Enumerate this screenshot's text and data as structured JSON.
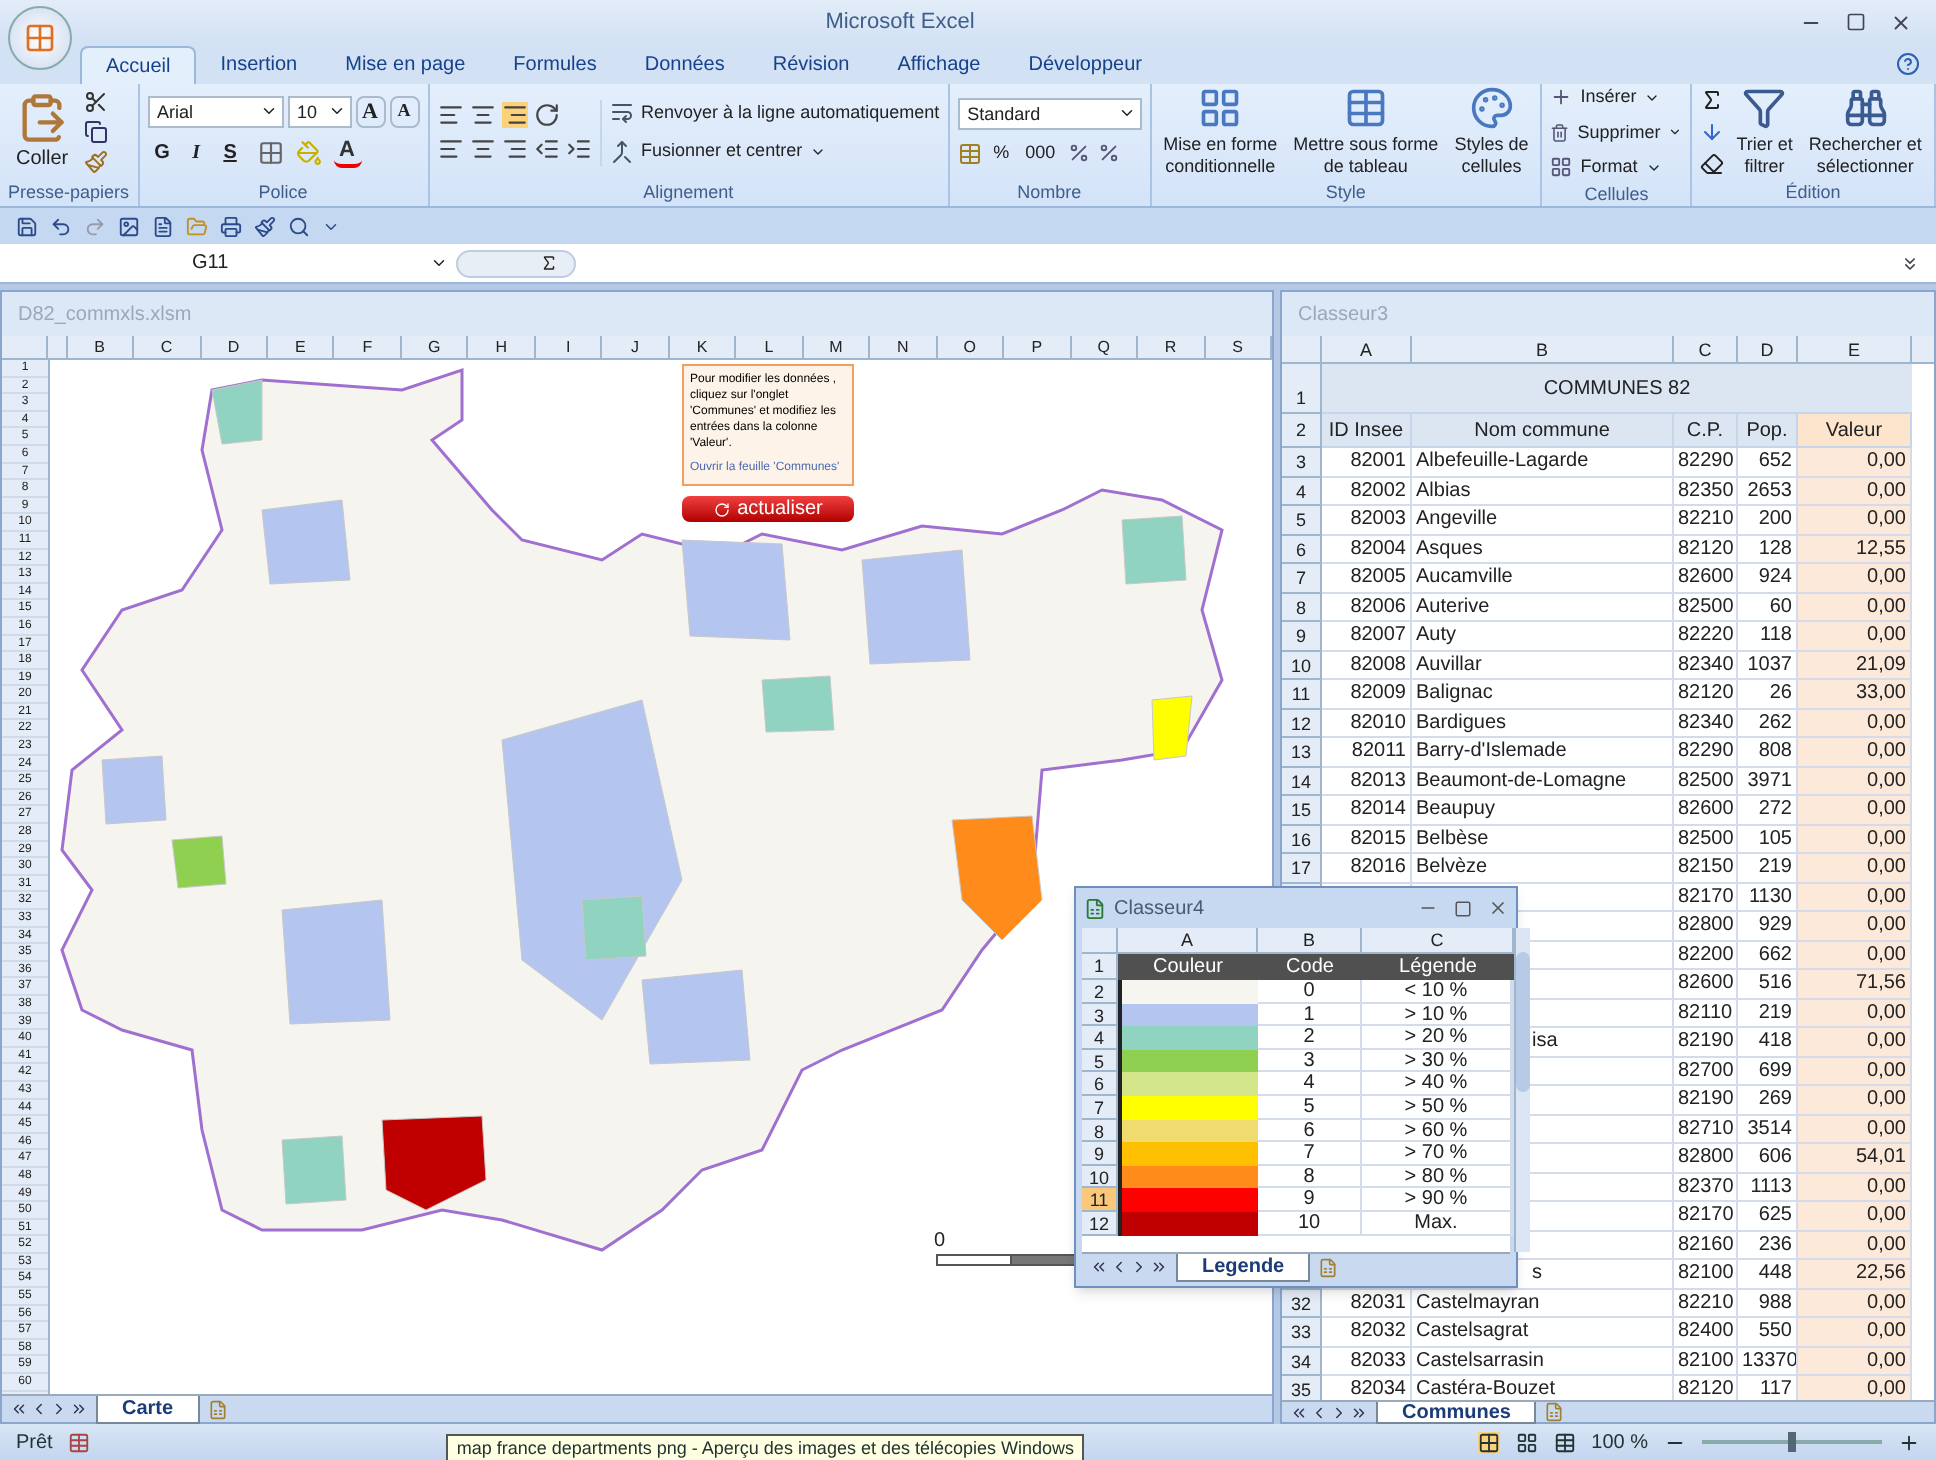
{
  "window": {
    "title": "Microsoft Excel"
  },
  "tabs": [
    {
      "label": "Accueil",
      "selected": true
    },
    {
      "label": "Insertion",
      "selected": false
    },
    {
      "label": "Mise en page",
      "selected": false
    },
    {
      "label": "Formules",
      "selected": false
    },
    {
      "label": "Données",
      "selected": false
    },
    {
      "label": "Révision",
      "selected": false
    },
    {
      "label": "Affichage",
      "selected": false
    },
    {
      "label": "Développeur",
      "selected": false
    }
  ],
  "ribbon": {
    "groups": [
      {
        "kind": "clipboard",
        "label": "Presse-papiers",
        "paste": "Coller"
      },
      {
        "kind": "font",
        "label": "Police",
        "font": "Arial",
        "size": "10",
        "grow": "A",
        "shrink": "A",
        "styles": [
          "G",
          "I",
          "S"
        ],
        "color_glyph": "A"
      },
      {
        "kind": "alignment",
        "label": "Alignement",
        "wrap": "Renvoyer à la ligne automatiquement",
        "merge": "Fusionner et centrer"
      },
      {
        "kind": "number",
        "label": "Nombre",
        "format": "Standard",
        "buttons": [
          "%",
          "000"
        ]
      },
      {
        "kind": "style",
        "label": "Style",
        "buttons": [
          [
            "Mise en forme",
            "conditionnelle"
          ],
          [
            "Mettre sous forme",
            "de tableau"
          ],
          [
            "Styles de",
            "cellules"
          ]
        ]
      },
      {
        "kind": "cells",
        "label": "Cellules",
        "buttons": [
          "Insérer",
          "Supprimer",
          "Format"
        ]
      },
      {
        "kind": "editing",
        "label": "Édition",
        "buttons": [
          [
            "Trier et",
            "filtrer"
          ],
          [
            "Rechercher et",
            "sélectionner"
          ]
        ]
      }
    ]
  },
  "formula_bar": {
    "name_box": "G11"
  },
  "map_sheet": {
    "title": "D82_commxls.xlsm",
    "columns": [
      "B",
      "C",
      "D",
      "E",
      "F",
      "G",
      "H",
      "I",
      "J",
      "K",
      "L",
      "M",
      "N",
      "O",
      "P",
      "Q",
      "R",
      "S"
    ],
    "rows": [
      "1",
      "2",
      "3",
      "4",
      "5",
      "6",
      "7",
      "8",
      "9",
      "10",
      "11",
      "12",
      "13",
      "14",
      "15",
      "16",
      "17",
      "18",
      "19",
      "20",
      "21",
      "22",
      "23",
      "24",
      "25",
      "26",
      "27",
      "28",
      "29",
      "30",
      "31",
      "32",
      "33",
      "34",
      "35",
      "36",
      "37",
      "38",
      "39",
      "40",
      "41",
      "42",
      "43",
      "44",
      "45",
      "46",
      "47",
      "48",
      "49",
      "50",
      "51",
      "52",
      "53",
      "54",
      "55",
      "56",
      "57",
      "58",
      "59",
      "60"
    ],
    "note": "Pour modifier les données , cliquez sur l'onglet 'Communes' et modifiez les entrées dans la colonne 'Valeur'.",
    "note_link": "Ouvrir la feuille 'Communes'",
    "refresh_button": "actualiser",
    "scale_label": "0",
    "sheet_tab": "Carte"
  },
  "communes_sheet": {
    "title": "Classeur3",
    "columns": [
      "A",
      "B",
      "C",
      "D",
      "E"
    ],
    "title_row": {
      "num": "1",
      "text": "COMMUNES 82"
    },
    "header_row": {
      "num": "2",
      "cells": [
        "ID Insee",
        "Nom commune",
        "C.P.",
        "Pop.",
        "Valeur"
      ]
    },
    "rows": [
      {
        "num": "3",
        "id": "82001",
        "name": "Albefeuille-Lagarde",
        "cp": "82290",
        "pop": "652",
        "value": "0,00"
      },
      {
        "num": "4",
        "id": "82002",
        "name": "Albias",
        "cp": "82350",
        "pop": "2653",
        "value": "0,00"
      },
      {
        "num": "5",
        "id": "82003",
        "name": "Angeville",
        "cp": "82210",
        "pop": "200",
        "value": "0,00"
      },
      {
        "num": "6",
        "id": "82004",
        "name": "Asques",
        "cp": "82120",
        "pop": "128",
        "value": "12,55"
      },
      {
        "num": "7",
        "id": "82005",
        "name": "Aucamville",
        "cp": "82600",
        "pop": "924",
        "value": "0,00"
      },
      {
        "num": "8",
        "id": "82006",
        "name": "Auterive",
        "cp": "82500",
        "pop": "60",
        "value": "0,00"
      },
      {
        "num": "9",
        "id": "82007",
        "name": "Auty",
        "cp": "82220",
        "pop": "118",
        "value": "0,00"
      },
      {
        "num": "10",
        "id": "82008",
        "name": "Auvillar",
        "cp": "82340",
        "pop": "1037",
        "value": "21,09"
      },
      {
        "num": "11",
        "id": "82009",
        "name": "Balignac",
        "cp": "82120",
        "pop": "26",
        "value": "33,00"
      },
      {
        "num": "12",
        "id": "82010",
        "name": "Bardigues",
        "cp": "82340",
        "pop": "262",
        "value": "0,00"
      },
      {
        "num": "13",
        "id": "82011",
        "name": "Barry-d'Islemade",
        "cp": "82290",
        "pop": "808",
        "value": "0,00"
      },
      {
        "num": "14",
        "id": "82013",
        "name": "Beaumont-de-Lomagne",
        "cp": "82500",
        "pop": "3971",
        "value": "0,00"
      },
      {
        "num": "15",
        "id": "82014",
        "name": "Beaupuy",
        "cp": "82600",
        "pop": "272",
        "value": "0,00"
      },
      {
        "num": "16",
        "id": "82015",
        "name": "Belbèse",
        "cp": "82500",
        "pop": "105",
        "value": "0,00"
      },
      {
        "num": "17",
        "id": "82016",
        "name": "Belvèze",
        "cp": "82150",
        "pop": "219",
        "value": "0,00"
      },
      {
        "cp": "82170",
        "pop": "1130",
        "value": "0,00"
      },
      {
        "cp": "82800",
        "pop": "929",
        "value": "0,00"
      },
      {
        "cp": "82200",
        "pop": "662",
        "value": "0,00"
      },
      {
        "cp": "82600",
        "pop": "516",
        "value": "71,56"
      },
      {
        "cp": "82110",
        "pop": "219",
        "value": "0,00"
      },
      {
        "name": "isa",
        "cp": "82190",
        "pop": "418",
        "value": "0,00"
      },
      {
        "cp": "82700",
        "pop": "699",
        "value": "0,00"
      },
      {
        "cp": "82190",
        "pop": "269",
        "value": "0,00"
      },
      {
        "cp": "82710",
        "pop": "3514",
        "value": "0,00"
      },
      {
        "cp": "82800",
        "pop": "606",
        "value": "54,01"
      },
      {
        "cp": "82370",
        "pop": "1113",
        "value": "0,00"
      },
      {
        "cp": "82170",
        "pop": "625",
        "value": "0,00"
      },
      {
        "cp": "82160",
        "pop": "236",
        "value": "0,00"
      },
      {
        "name": "s",
        "cp": "82100",
        "pop": "448",
        "value": "22,56"
      },
      {
        "num": "32",
        "id": "82031",
        "name": "Castelmayran",
        "cp": "82210",
        "pop": "988",
        "value": "0,00"
      },
      {
        "num": "33",
        "id": "82032",
        "name": "Castelsagrat",
        "cp": "82400",
        "pop": "550",
        "value": "0,00"
      },
      {
        "num": "34",
        "id": "82033",
        "name": "Castelsarrasin",
        "cp": "82100",
        "pop": "13370",
        "value": "0,00"
      },
      {
        "num": "35",
        "id": "82034",
        "name": "Castéra-Bouzet",
        "cp": "82120",
        "pop": "117",
        "value": "0,00"
      }
    ],
    "sheet_tab": "Communes"
  },
  "legend_window": {
    "title": "Classeur4",
    "columns": [
      "A",
      "B",
      "C"
    ],
    "header": {
      "num": "1",
      "cells": [
        "Couleur",
        "Code",
        "Légende"
      ]
    },
    "rows": [
      {
        "num": "2",
        "color": "#f7f5f0",
        "code": "0",
        "label": "< 10 %",
        "selected": false
      },
      {
        "num": "3",
        "color": "#b4c6f0",
        "code": "1",
        "label": "> 10 %",
        "selected": false
      },
      {
        "num": "4",
        "color": "#8fd3c0",
        "code": "2",
        "label": "> 20 %",
        "selected": false
      },
      {
        "num": "5",
        "color": "#8fd050",
        "code": "3",
        "label": "> 30 %",
        "selected": false
      },
      {
        "num": "6",
        "color": "#d4e68a",
        "code": "4",
        "label": "> 40 %",
        "selected": false
      },
      {
        "num": "7",
        "color": "#ffff00",
        "code": "5",
        "label": "> 50 %",
        "selected": false
      },
      {
        "num": "8",
        "color": "#f0dc6e",
        "code": "6",
        "label": "> 60 %",
        "selected": false
      },
      {
        "num": "9",
        "color": "#ffc000",
        "code": "7",
        "label": "> 70 %",
        "selected": false
      },
      {
        "num": "10",
        "color": "#ff8c1a",
        "code": "8",
        "label": "> 80 %",
        "selected": false
      },
      {
        "num": "11",
        "color": "#ff0000",
        "code": "9",
        "label": "> 90 %",
        "selected": true
      },
      {
        "num": "12",
        "color": "#c00000",
        "code": "10",
        "label": "Max.",
        "selected": false
      }
    ],
    "sheet_tab": "Legende"
  },
  "status_bar": {
    "state": "Prêt",
    "zoom": "100 %",
    "zoom_slider": {
      "level": 0.5
    },
    "tooltip": "map france departments png - Aperçu des images et des télécopies Windows"
  }
}
